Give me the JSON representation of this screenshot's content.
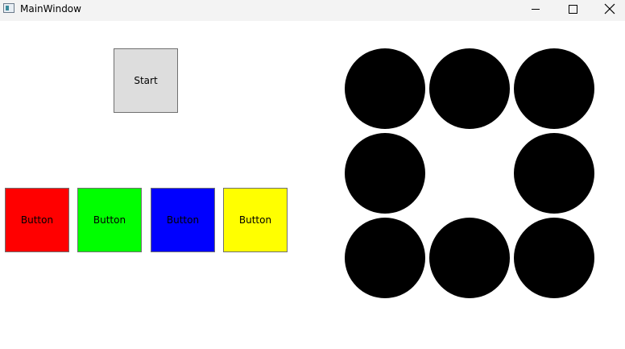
{
  "window": {
    "title": "MainWindow"
  },
  "start_button": {
    "label": "Start",
    "color": "#dddddd"
  },
  "color_buttons": [
    {
      "label": "Button",
      "color": "#ff0000"
    },
    {
      "label": "Button",
      "color": "#00ff00"
    },
    {
      "label": "Button",
      "color": "#0000ff"
    },
    {
      "label": "Button",
      "color": "#ffff00"
    }
  ],
  "circles": {
    "color": "#000000",
    "cells": [
      "filled",
      "filled",
      "filled",
      "filled",
      "empty",
      "filled",
      "filled",
      "filled",
      "filled"
    ]
  }
}
